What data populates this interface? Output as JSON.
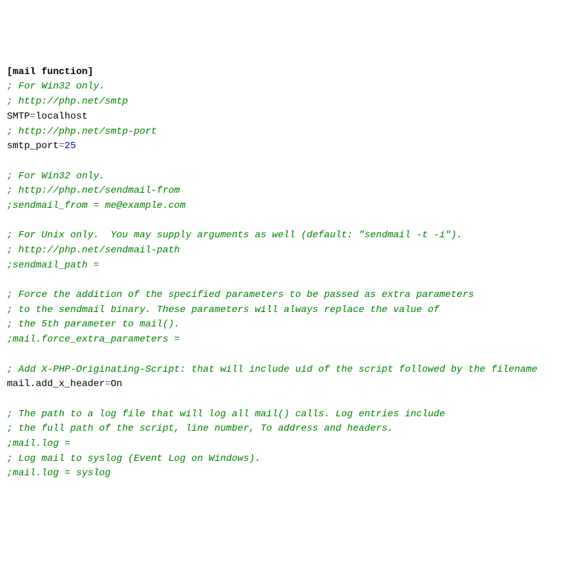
{
  "lines": [
    {
      "type": "section",
      "text": "[mail function]"
    },
    {
      "type": "comment",
      "text": "; For Win32 only."
    },
    {
      "type": "comment",
      "text": "; http://php.net/smtp"
    },
    {
      "type": "kv",
      "key": "SMTP",
      "value": "localhost",
      "valueIsNumber": false
    },
    {
      "type": "comment",
      "text": "; http://php.net/smtp-port"
    },
    {
      "type": "kv",
      "key": "smtp_port",
      "value": "25",
      "valueIsNumber": true
    },
    {
      "type": "blank",
      "text": ""
    },
    {
      "type": "comment",
      "text": "; For Win32 only."
    },
    {
      "type": "comment",
      "text": "; http://php.net/sendmail-from"
    },
    {
      "type": "comment",
      "text": ";sendmail_from = me@example.com"
    },
    {
      "type": "blank",
      "text": ""
    },
    {
      "type": "comment",
      "text": "; For Unix only.  You may supply arguments as well (default: \"sendmail -t -i\")."
    },
    {
      "type": "comment",
      "text": "; http://php.net/sendmail-path"
    },
    {
      "type": "comment",
      "text": ";sendmail_path ="
    },
    {
      "type": "blank",
      "text": ""
    },
    {
      "type": "comment",
      "text": "; Force the addition of the specified parameters to be passed as extra parameters"
    },
    {
      "type": "comment",
      "text": "; to the sendmail binary. These parameters will always replace the value of"
    },
    {
      "type": "comment",
      "text": "; the 5th parameter to mail()."
    },
    {
      "type": "comment",
      "text": ";mail.force_extra_parameters ="
    },
    {
      "type": "blank",
      "text": ""
    },
    {
      "type": "comment",
      "text": "; Add X-PHP-Originating-Script: that will include uid of the script followed by the filename"
    },
    {
      "type": "kv",
      "key": "mail.add_x_header",
      "value": "On",
      "valueIsNumber": false
    },
    {
      "type": "blank",
      "text": ""
    },
    {
      "type": "comment",
      "text": "; The path to a log file that will log all mail() calls. Log entries include"
    },
    {
      "type": "comment",
      "text": "; the full path of the script, line number, To address and headers."
    },
    {
      "type": "comment",
      "text": ";mail.log ="
    },
    {
      "type": "comment",
      "text": "; Log mail to syslog (Event Log on Windows)."
    },
    {
      "type": "comment",
      "text": ";mail.log = syslog"
    }
  ]
}
